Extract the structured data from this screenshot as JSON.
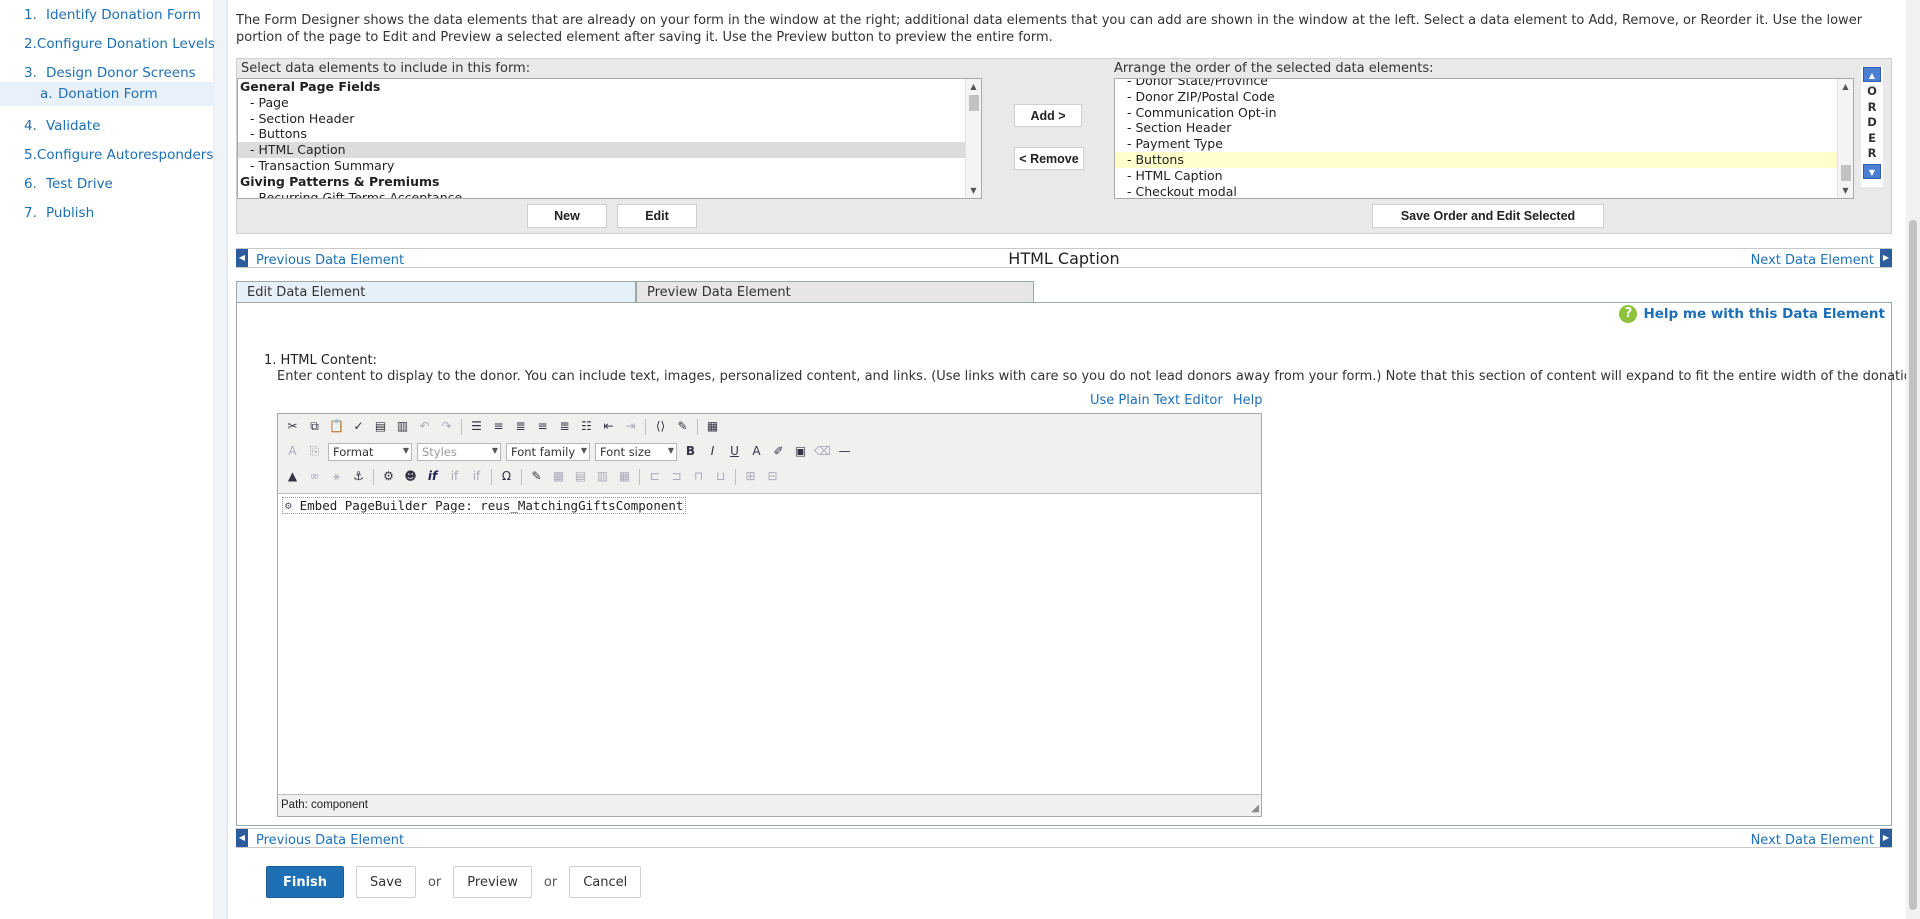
{
  "sidebar": {
    "steps": [
      {
        "num": "1.",
        "label": "Identify Donation Form"
      },
      {
        "num": "2.",
        "label": "Configure Donation Levels"
      },
      {
        "num": "3.",
        "label": "Design Donor Screens"
      },
      {
        "num": "a.",
        "label": "Donation Form"
      },
      {
        "num": "4.",
        "label": "Validate"
      },
      {
        "num": "5.",
        "label": "Configure Autoresponders"
      },
      {
        "num": "6.",
        "label": "Test Drive"
      },
      {
        "num": "7.",
        "label": "Publish"
      }
    ]
  },
  "intro": "The Form Designer shows the data elements that are already on your form in the window at the right; additional data elements that you can add are shown in the window at the left. Select a data element to Add, Remove, or Reorder it. Use the lower portion of the page to Edit and Preview a selected element after saving it. Use the Preview button to preview the entire form.",
  "designer": {
    "left_label": "Select data elements to include in this form:",
    "right_label": "Arrange the order of the selected data elements:",
    "left_options": [
      {
        "text": "General Page Fields",
        "group": true
      },
      {
        "text": "- Page"
      },
      {
        "text": "- Section Header"
      },
      {
        "text": "- Buttons"
      },
      {
        "text": "- HTML Caption",
        "selected": true
      },
      {
        "text": "- Transaction Summary"
      },
      {
        "text": "Giving Patterns & Premiums",
        "group": true
      },
      {
        "text": "- Recurring Gift Terms Acceptance"
      }
    ],
    "right_options": [
      {
        "text": "- Donor State/Province"
      },
      {
        "text": "- Donor ZIP/Postal Code"
      },
      {
        "text": "- Communication Opt-in"
      },
      {
        "text": "- Section Header"
      },
      {
        "text": "- Payment Type"
      },
      {
        "text": "- Buttons",
        "selected": true
      },
      {
        "text": "- HTML Caption"
      },
      {
        "text": "- Checkout modal"
      }
    ],
    "add_label": "Add >",
    "remove_label": "< Remove",
    "new_label": "New",
    "edit_label": "Edit",
    "save_order_label": "Save Order and Edit Selected",
    "order_letters": [
      "O",
      "R",
      "D",
      "E",
      "R"
    ]
  },
  "nav": {
    "prev": "Previous Data Element",
    "next": "Next Data Element",
    "title": "HTML Caption"
  },
  "tabs": {
    "edit": "Edit Data Element",
    "preview": "Preview Data Element"
  },
  "panel": {
    "help": "Help me with this Data Element",
    "field_num": "1.",
    "field_title": "HTML Content:",
    "field_desc": "Enter content to display to the donor. You can include text, images, personalized content, and links. (Use links with care so you do not lead donors away from your form.) Note that this section of content will expand to fit the entire width of the donation form.",
    "plain_text": "Use Plain Text Editor",
    "help_link": "Help"
  },
  "editor": {
    "format": "Format",
    "styles": "Styles",
    "font_family": "Font family",
    "font_size": "Font size",
    "content": "Embed PageBuilder Page: reus_MatchingGiftsComponent",
    "path": "Path: component"
  },
  "actions": {
    "finish": "Finish",
    "save": "Save",
    "or1": "or",
    "preview": "Preview",
    "or2": "or",
    "cancel": "Cancel"
  }
}
